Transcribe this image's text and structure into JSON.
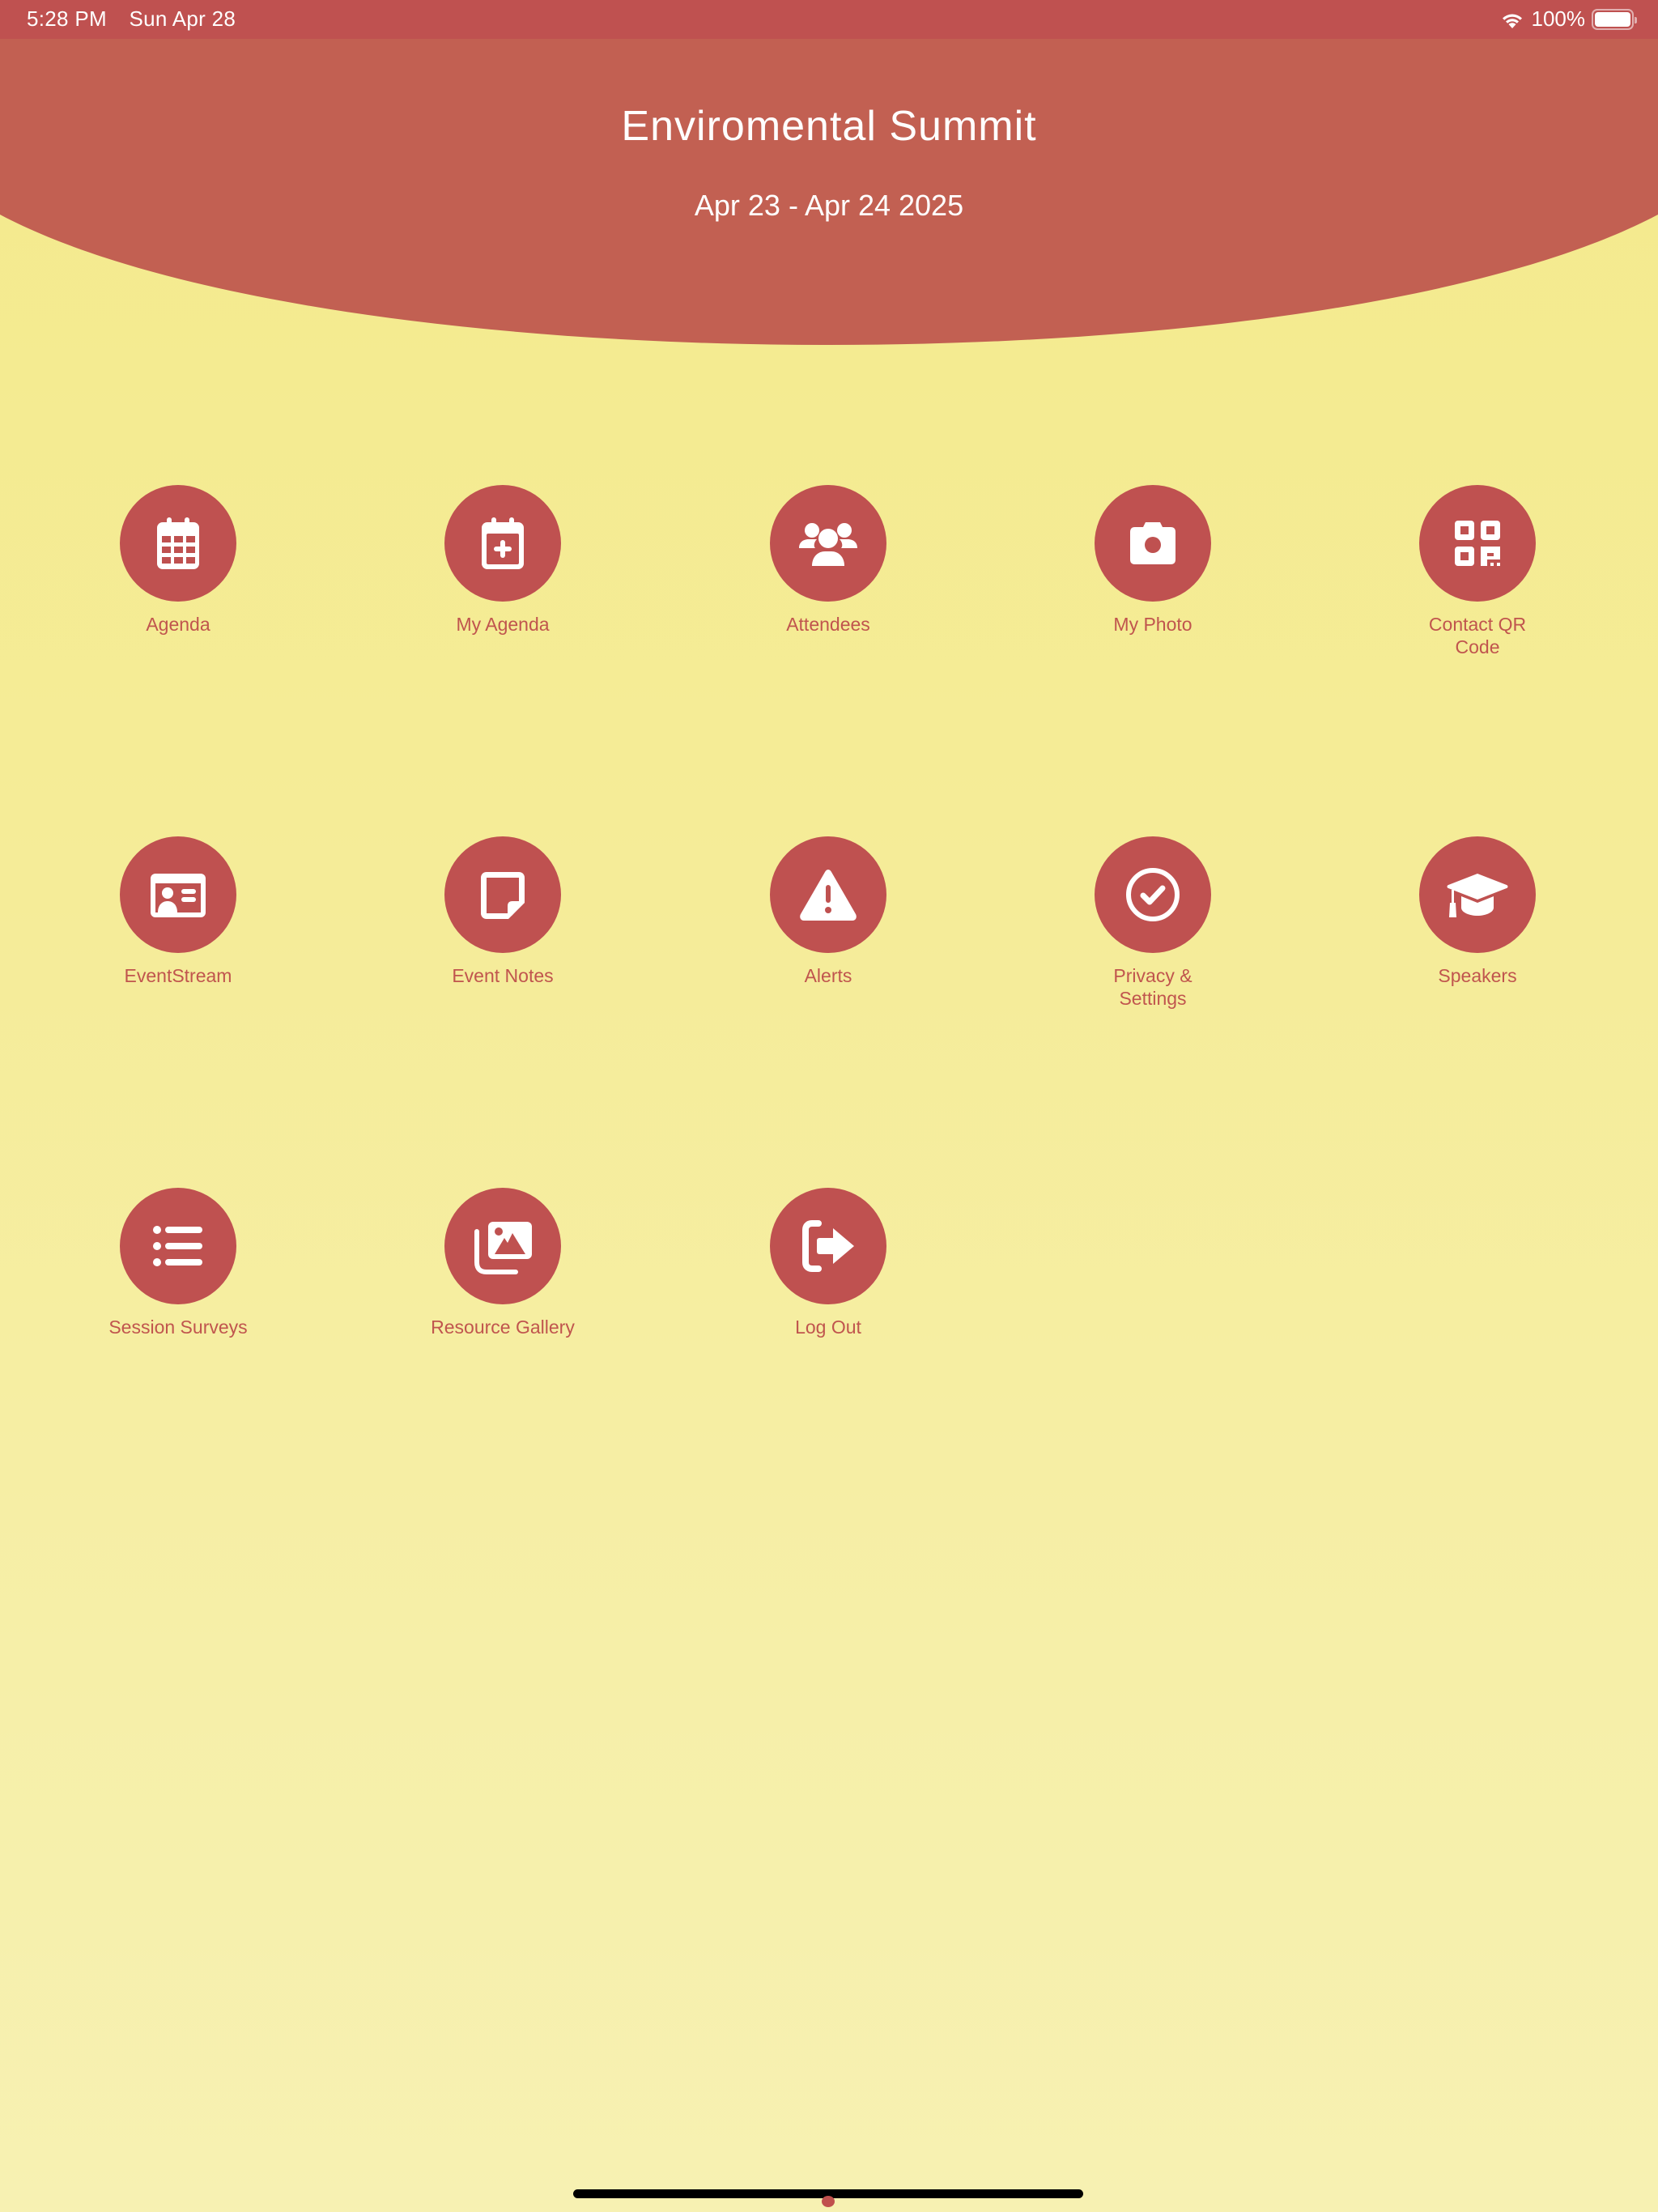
{
  "status_bar": {
    "time": "5:28 PM",
    "date": "Sun Apr 28",
    "battery_percent": "100%",
    "battery_level": 1.0,
    "wifi_icon": "wifi-icon",
    "battery_icon": "battery-icon"
  },
  "header": {
    "title": "Enviromental Summit",
    "dates": "Apr 23 - Apr 24 2025"
  },
  "colors": {
    "accent": "#bf5150",
    "header": "#c26052",
    "label": "#c0554e",
    "background_top": "#f4ea8c",
    "background_bottom": "#f7f1b2"
  },
  "menu": {
    "items": [
      {
        "label": "Agenda",
        "icon": "calendar-icon"
      },
      {
        "label": "My Agenda",
        "icon": "calendar-plus-icon"
      },
      {
        "label": "Attendees",
        "icon": "users-icon"
      },
      {
        "label": "My Photo",
        "icon": "camera-icon"
      },
      {
        "label": "Contact QR Code",
        "icon": "qr-code-icon"
      },
      {
        "label": "EventStream",
        "icon": "id-card-icon"
      },
      {
        "label": "Event Notes",
        "icon": "sticky-note-icon"
      },
      {
        "label": "Alerts",
        "icon": "warning-icon"
      },
      {
        "label": "Privacy & Settings",
        "icon": "check-circle-icon"
      },
      {
        "label": "Speakers",
        "icon": "graduation-cap-icon"
      },
      {
        "label": "Session Surveys",
        "icon": "list-icon"
      },
      {
        "label": "Resource Gallery",
        "icon": "images-icon"
      },
      {
        "label": "Log Out",
        "icon": "logout-icon"
      }
    ]
  }
}
